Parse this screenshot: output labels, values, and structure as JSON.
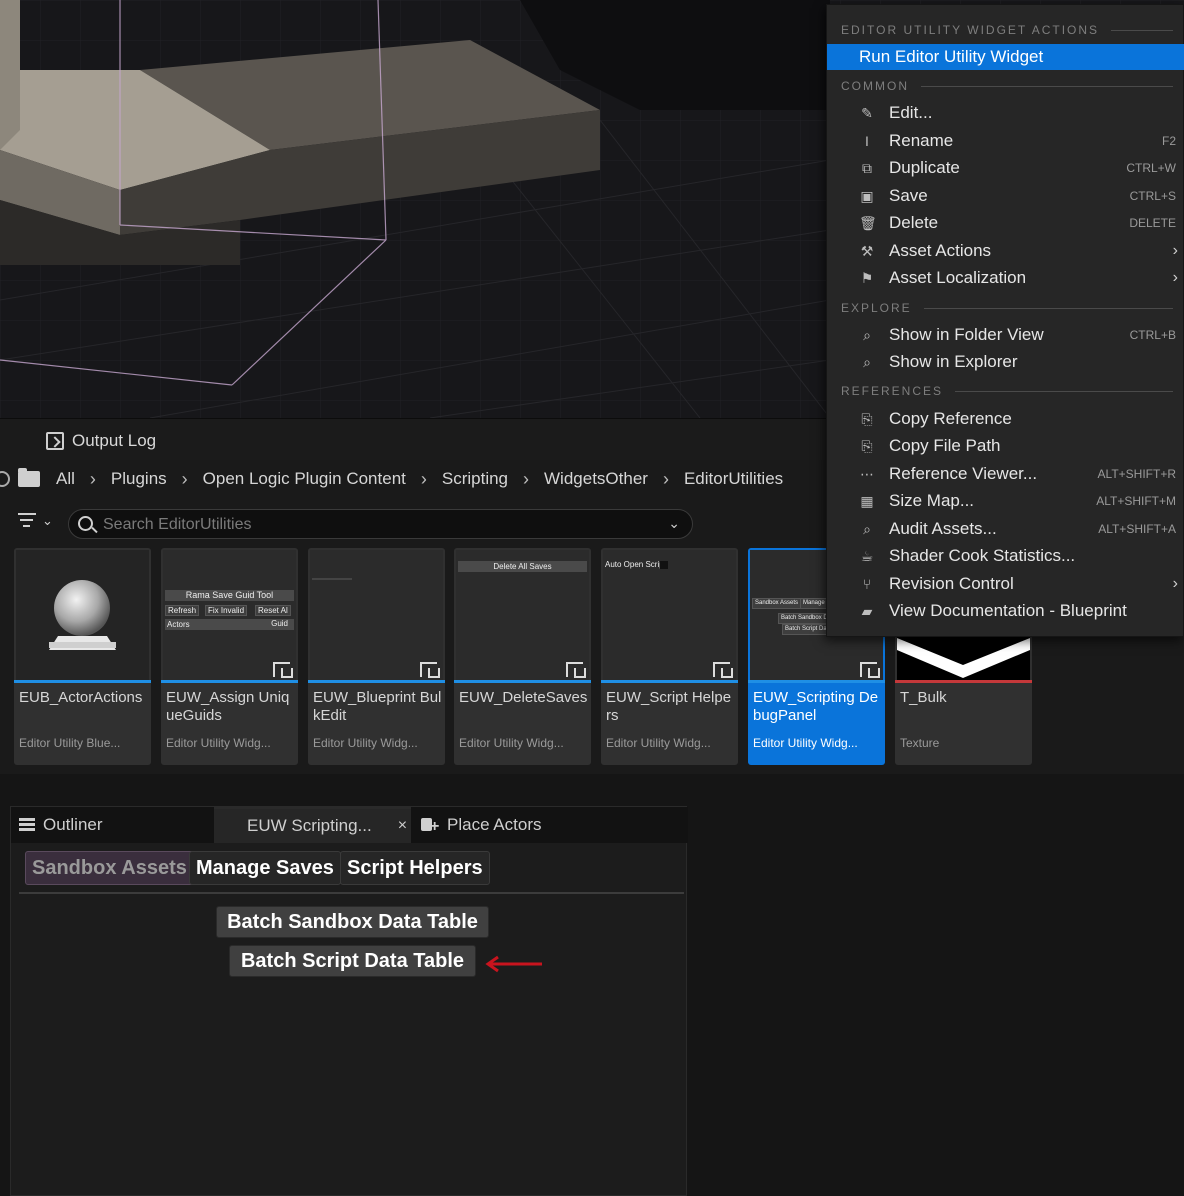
{
  "output_log": {
    "label": "Output Log"
  },
  "breadcrumb": [
    "All",
    "Plugins",
    "Open Logic Plugin Content",
    "Scripting",
    "WidgetsOther",
    "EditorUtilities"
  ],
  "search": {
    "placeholder": "Search EditorUtilities"
  },
  "assets": [
    {
      "name": "EUB_ActorActions",
      "type": "Editor Utility Blue..."
    },
    {
      "name": "EUW_Assign UniqueGuids",
      "type": "Editor Utility Widg..."
    },
    {
      "name": "EUW_Blueprint BulkEdit",
      "type": "Editor Utility Widg..."
    },
    {
      "name": "EUW_DeleteSaves",
      "type": "Editor Utility Widg..."
    },
    {
      "name": "EUW_Script Helpers",
      "type": "Editor Utility Widg..."
    },
    {
      "name": "EUW_Scripting DebugPanel",
      "type": "Editor Utility Widg..."
    },
    {
      "name": "T_Bulk",
      "type": "Texture"
    }
  ],
  "thumbs": {
    "guid_tool_title": "Rama Save Guid Tool",
    "guid_refresh": "Refresh",
    "guid_fix": "Fix Invalid",
    "guid_reset": "Reset Al",
    "guid_actors": "Actors",
    "guid_guid": "Guid",
    "delete_all_saves": "Delete All Saves",
    "auto_open_script": "Auto Open Script",
    "debug_sandbox": "Sandbox Assets",
    "debug_manage": "Manage",
    "debug_batch_sandbox": "Batch Sandbox D",
    "debug_batch_script": "Batch Script Da"
  },
  "panel": {
    "tabs": {
      "outliner": "Outliner",
      "euw": "EUW Scripting...",
      "place": "Place Actors"
    },
    "close_glyph": "×",
    "sub_tabs": [
      "Sandbox Assets",
      "Manage Saves",
      "Script Helpers"
    ],
    "batch_sandbox": "Batch Sandbox Data Table",
    "batch_script": "Batch Script Data Table"
  },
  "context_menu": {
    "header_widget": "EDITOR UTILITY WIDGET ACTIONS",
    "run": "Run Editor Utility Widget",
    "header_common": "COMMON",
    "common": [
      {
        "label": "Edit...",
        "shortcut": "",
        "icon": "✎"
      },
      {
        "label": "Rename",
        "shortcut": "F2",
        "icon": "I"
      },
      {
        "label": "Duplicate",
        "shortcut": "CTRL+W",
        "icon": "⧉"
      },
      {
        "label": "Save",
        "shortcut": "CTRL+S",
        "icon": "▣"
      },
      {
        "label": "Delete",
        "shortcut": "DELETE",
        "icon": "🗑"
      },
      {
        "label": "Asset Actions",
        "shortcut": "",
        "icon": "⚒",
        "sub": "›"
      },
      {
        "label": "Asset Localization",
        "shortcut": "",
        "icon": "⚑",
        "sub": "›"
      }
    ],
    "header_explore": "EXPLORE",
    "explore": [
      {
        "label": "Show in Folder View",
        "shortcut": "CTRL+B",
        "icon": "⌕"
      },
      {
        "label": "Show in Explorer",
        "shortcut": "",
        "icon": "⌕"
      }
    ],
    "header_references": "REFERENCES",
    "references": [
      {
        "label": "Copy Reference",
        "shortcut": "",
        "icon": "⎘"
      },
      {
        "label": "Copy File Path",
        "shortcut": "",
        "icon": "⎘"
      },
      {
        "label": "Reference Viewer...",
        "shortcut": "ALT+SHIFT+R",
        "icon": "⋯"
      },
      {
        "label": "Size Map...",
        "shortcut": "ALT+SHIFT+M",
        "icon": "▦"
      },
      {
        "label": "Audit Assets...",
        "shortcut": "ALT+SHIFT+A",
        "icon": "⌕"
      },
      {
        "label": "Shader Cook Statistics...",
        "shortcut": "",
        "icon": "☕"
      },
      {
        "label": "Revision Control",
        "shortcut": "",
        "icon": "⑂",
        "sub": "›"
      },
      {
        "label": "View Documentation - Blueprint",
        "shortcut": "",
        "icon": "▰"
      }
    ]
  },
  "colors": {
    "accent": "#0a74da",
    "widget_strip": "#1f8fe5",
    "texture_strip": "#c4383a",
    "arrow": "#c8141e"
  }
}
